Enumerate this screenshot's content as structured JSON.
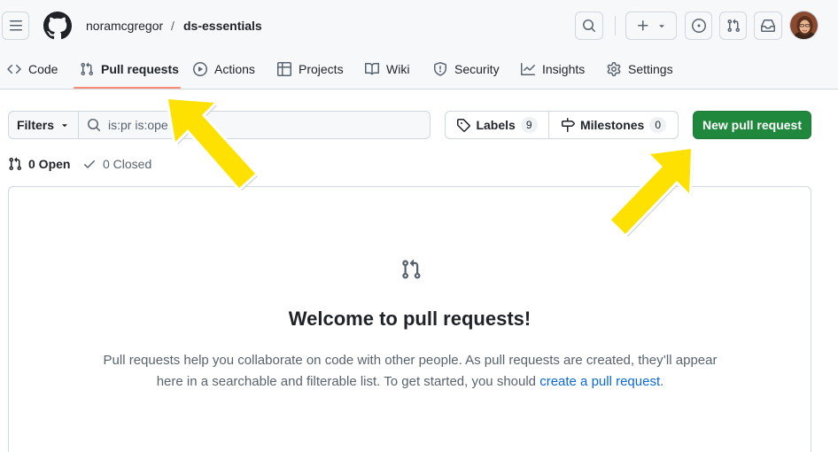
{
  "header": {
    "owner": "noramcgregor",
    "separator": "/",
    "repo": "ds-essentials"
  },
  "tabs": [
    {
      "label": "Code"
    },
    {
      "label": "Pull requests"
    },
    {
      "label": "Actions"
    },
    {
      "label": "Projects"
    },
    {
      "label": "Wiki"
    },
    {
      "label": "Security"
    },
    {
      "label": "Insights"
    },
    {
      "label": "Settings"
    }
  ],
  "toolbar": {
    "filters_label": "Filters",
    "search_value": "is:pr is:ope",
    "labels_label": "Labels",
    "labels_count": "9",
    "milestones_label": "Milestones",
    "milestones_count": "0",
    "new_pr_label": "New pull request"
  },
  "state": {
    "open_label": "0 Open",
    "closed_label": "0 Closed"
  },
  "blankslate": {
    "title": "Welcome to pull requests!",
    "text_1": "Pull requests help you collaborate on code with other people. As pull requests are created, they’ll appear here in a searchable and filterable list. To get started, you should ",
    "link": "create a pull request",
    "text_2": "."
  },
  "annotations": {
    "arrow_color": "#ffe100"
  },
  "colors": {
    "primary_button": "#1f883d",
    "tab_underline": "#fd8c73",
    "link": "#0969da"
  }
}
